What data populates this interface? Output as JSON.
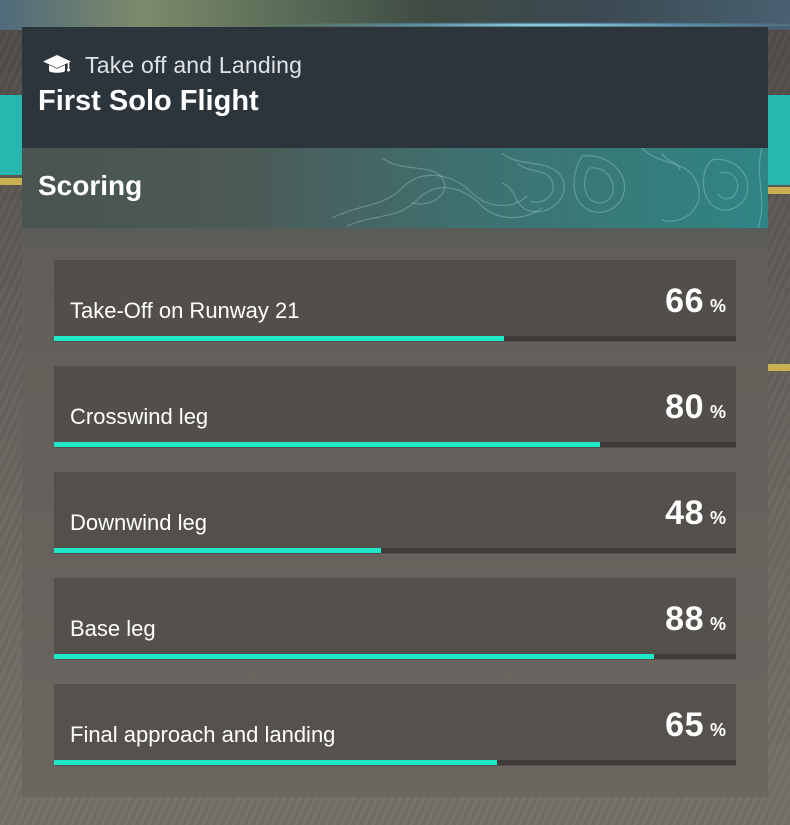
{
  "header": {
    "category_icon": "graduation-cap-icon",
    "category_label": "Take off and Landing",
    "lesson_title": "First Solo Flight"
  },
  "scoring": {
    "title": "Scoring",
    "unit": "%",
    "items": [
      {
        "label": "Take-Off on Runway 21",
        "score": "66",
        "progress": 0.66
      },
      {
        "label": "Crosswind leg",
        "score": "80",
        "progress": 0.8
      },
      {
        "label": "Downwind leg",
        "score": "48",
        "progress": 0.48
      },
      {
        "label": "Base leg",
        "score": "88",
        "progress": 0.88
      },
      {
        "label": "Final approach and landing",
        "score": "65",
        "progress": 0.65
      }
    ]
  },
  "colors": {
    "accent": "#1de9c8",
    "header_bg": "#2c353c",
    "track": "#3e3b38"
  }
}
